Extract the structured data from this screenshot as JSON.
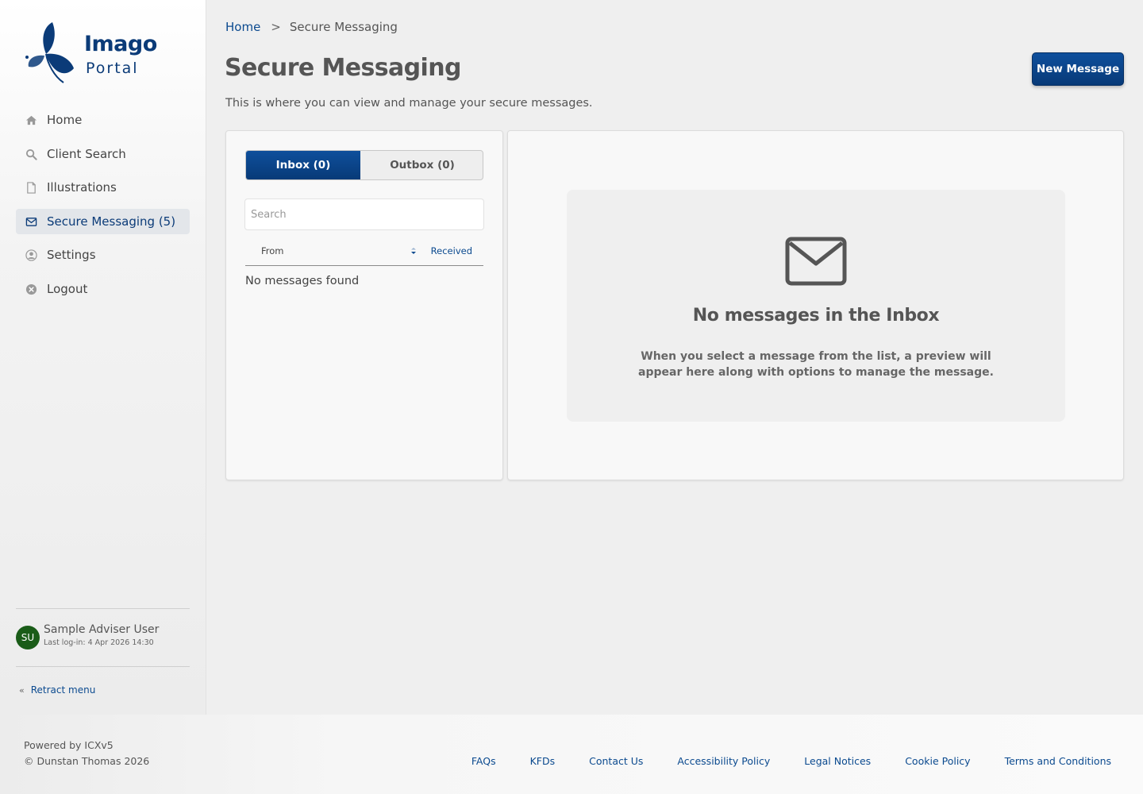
{
  "logo": {
    "name": "Imago",
    "sub": "Portal"
  },
  "sidebar": {
    "items": [
      {
        "label": "Home",
        "icon": "home-icon"
      },
      {
        "label": "Client Search",
        "icon": "search-icon"
      },
      {
        "label": "Illustrations",
        "icon": "document-icon"
      },
      {
        "label": "Secure Messaging (5)",
        "icon": "envelope-icon",
        "active": true
      },
      {
        "label": "Settings",
        "icon": "user-circle-icon"
      },
      {
        "label": "Logout",
        "icon": "close-circle-icon"
      }
    ],
    "user": {
      "initials": "SU",
      "name": "Sample Adviser User",
      "last_login": "Last log-in: 4 Apr 2026 14:30"
    },
    "retract_label": "Retract menu",
    "retract_chevron": "«"
  },
  "breadcrumb": {
    "home": "Home",
    "separator": ">",
    "current": "Secure Messaging"
  },
  "page": {
    "title": "Secure Messaging",
    "description": "This is where you can view and manage your secure messages.",
    "new_message_label": "New Message"
  },
  "messages": {
    "tabs": [
      {
        "label": "Inbox (0)",
        "active": true
      },
      {
        "label": "Outbox (0)",
        "active": false
      }
    ],
    "search_placeholder": "Search",
    "columns": {
      "from": "From",
      "received": "Received"
    },
    "empty_list": "No messages found"
  },
  "preview": {
    "title": "No messages in the Inbox",
    "description": "When you select a message from the list, a preview will appear here along with options to manage the message."
  },
  "footer": {
    "powered_by": "Powered by ICXv5",
    "copyright": "© Dunstan Thomas 2026",
    "links": [
      "FAQs",
      "KFDs",
      "Contact Us",
      "Accessibility Policy",
      "Legal Notices",
      "Cookie Policy",
      "Terms and Conditions"
    ]
  },
  "colors": {
    "brand": "#0b3b78",
    "link": "#0b4a8f",
    "avatar": "#1a5c18"
  }
}
